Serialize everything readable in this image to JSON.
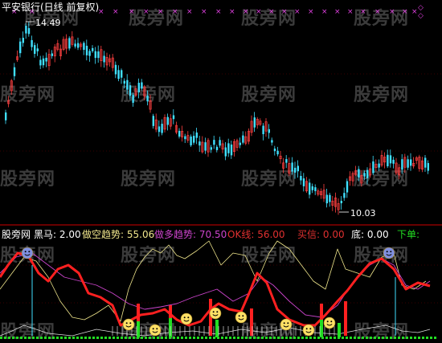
{
  "title_bar": {
    "text": "平安银行(日线 前复权)"
  },
  "main_chart": {
    "high_label": "14.49",
    "low_label": "10.03"
  },
  "indicator": {
    "name": "股旁网",
    "fields": [
      {
        "label": "黑马:",
        "value": "2.00",
        "color": "#ffffff"
      },
      {
        "label": "做空趋势:",
        "value": "55.06",
        "color": "#f0e68c"
      },
      {
        "label": "做多趋势:",
        "value": "70.50",
        "color": "#cc44cc"
      },
      {
        "label": "OK线:",
        "value": "56.00",
        "color": "#e03030"
      },
      {
        "label": "买信:",
        "value": "0.00",
        "color": "#e03030"
      },
      {
        "label": "底:",
        "value": "0.00",
        "color": "#ffffff"
      },
      {
        "label": "下单:",
        "value": "",
        "color": "#22dd22"
      }
    ]
  },
  "watermark": {
    "text": "股旁网"
  },
  "colors": {
    "background": "#000000",
    "candle_up": "#ff4040",
    "candle_down": "#40e0ff",
    "divider": "#8b0000",
    "gridline": "#700000",
    "short_trend_line": "#f0e68c",
    "long_trend_line": "#cc44cc",
    "ok_line": "#ff2020",
    "buy_bar": "#22dd22",
    "smiley": "#ffe066"
  }
}
